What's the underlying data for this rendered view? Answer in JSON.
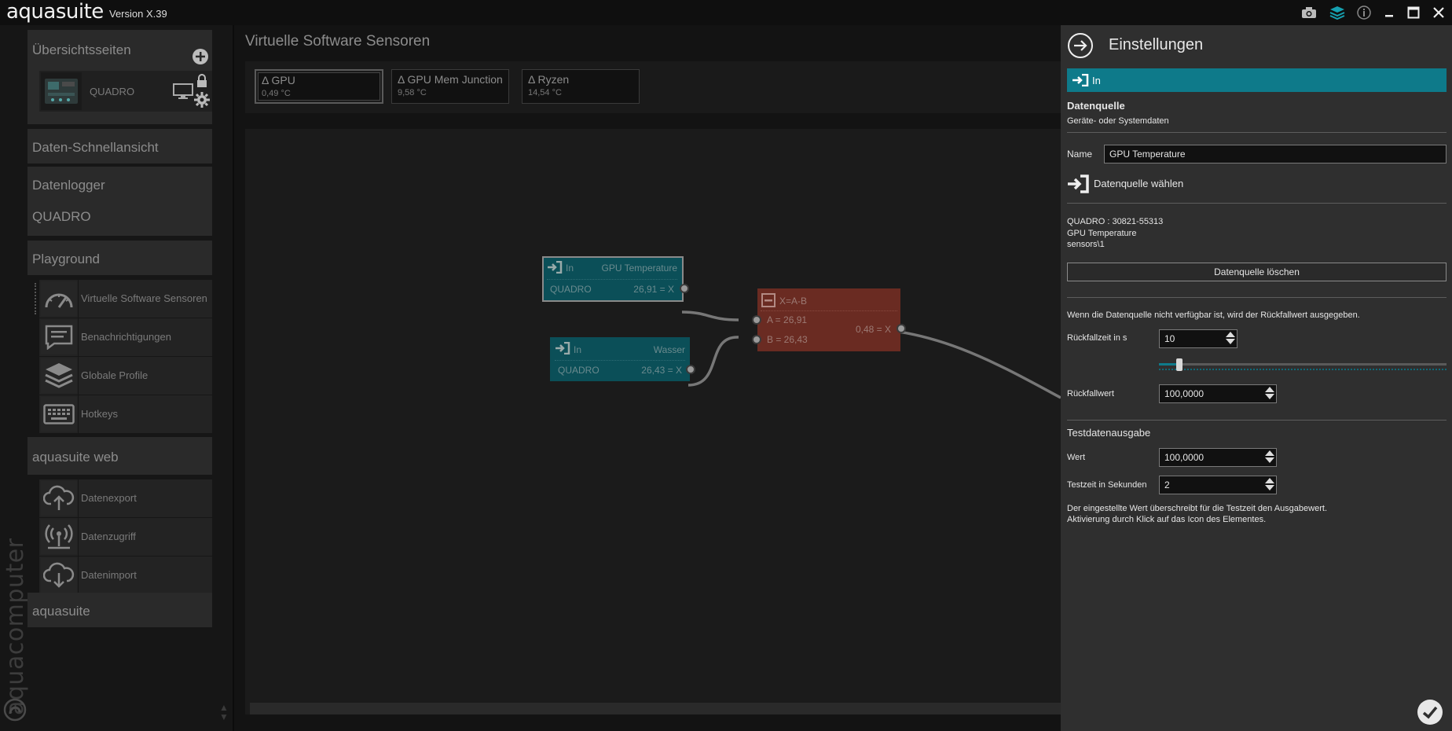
{
  "app": {
    "name": "aquasuite",
    "version": "Version X.39",
    "vertical_brand": "aquacomputer"
  },
  "sidebar": {
    "sections": [
      {
        "label": "Übersichtsseiten"
      },
      {
        "label": "Daten-Schnellansicht"
      },
      {
        "label": "Datenlogger"
      },
      {
        "label": "QUADRO"
      },
      {
        "label": "Playground"
      },
      {
        "label": "aquasuite web"
      },
      {
        "label": "aquasuite"
      }
    ],
    "overview_item": {
      "label": "QUADRO"
    },
    "playground_items": [
      {
        "label": "Virtuelle Software Sensoren",
        "icon": "gauge-icon"
      },
      {
        "label": "Benachrichtigungen",
        "icon": "message-icon"
      },
      {
        "label": "Globale Profile",
        "icon": "layers-icon"
      },
      {
        "label": "Hotkeys",
        "icon": "keyboard-icon"
      }
    ],
    "web_items": [
      {
        "label": "Datenexport",
        "icon": "cloud-upload-icon"
      },
      {
        "label": "Datenzugriff",
        "icon": "antenna-icon"
      },
      {
        "label": "Datenimport",
        "icon": "cloud-download-icon"
      }
    ]
  },
  "main": {
    "title": "Virtuelle Software Sensoren",
    "sensors": [
      {
        "name": "Δ GPU",
        "value": "0,49 °C"
      },
      {
        "name": "Δ GPU Mem Junction",
        "value": "9,58 °C"
      },
      {
        "name": "Δ Ryzen",
        "value": "14,54 °C"
      }
    ],
    "nodes": {
      "in1": {
        "type": "In",
        "name": "GPU Temperature",
        "source": "QUADRO",
        "output": "26,91 = X"
      },
      "in2": {
        "type": "In",
        "name": "Wasser",
        "source": "QUADRO",
        "output": "26,43 = X"
      },
      "op": {
        "formula": "X=A-B",
        "a": "A = 26,91",
        "b": "B = 26,43",
        "output": "0,48 = X"
      }
    }
  },
  "panel": {
    "title": "Einstellungen",
    "type_label": "In",
    "datasource_heading": "Datenquelle",
    "datasource_sub": "Geräte- oder Systemdaten",
    "name_label": "Name",
    "name_value": "GPU Temperature",
    "choose_source": "Datenquelle wählen",
    "source_info": [
      "QUADRO : 30821-55313",
      "GPU Temperature",
      "sensors\\1"
    ],
    "delete_button": "Datenquelle löschen",
    "fallback_note": "Wenn die Datenquelle nicht verfügbar ist, wird der Rückfallwert ausgegeben.",
    "fallback_time_label": "Rückfallzeit in s",
    "fallback_time_value": "10",
    "fallback_time_slider": 0.07,
    "fallback_value_label": "Rückfallwert",
    "fallback_value": "100,0000",
    "test_heading": "Testdatenausgabe",
    "test_value_label": "Wert",
    "test_value": "100,0000",
    "test_time_label": "Testzeit in Sekunden",
    "test_time_value": "2",
    "test_note": [
      "Der eingestellte Wert überschreibt für die Testzeit den Ausgabewert.",
      "Aktivierung durch Klick auf das Icon des Elementes."
    ]
  },
  "colors": {
    "accent": "#0e7a8a",
    "in_node": "#0b4f58",
    "op_node": "#6a2b22",
    "panel_bg": "#2f2f2f"
  }
}
